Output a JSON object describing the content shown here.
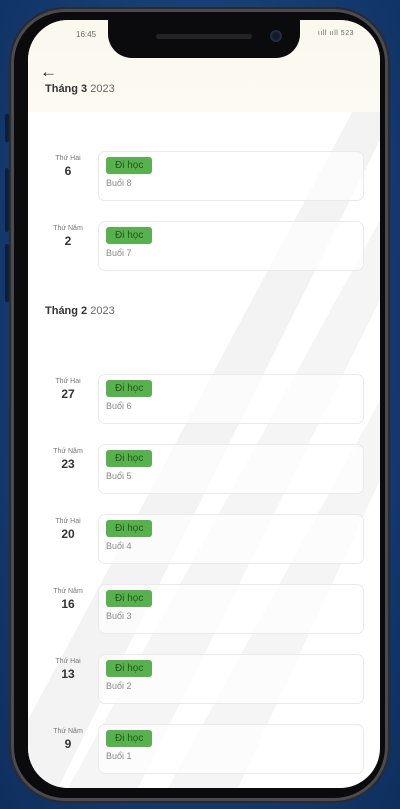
{
  "status": {
    "time": "16:45",
    "indicators": "ııll ııll 523"
  },
  "nav": {
    "back_icon": "←"
  },
  "sections": [
    {
      "month_label": "Tháng 3",
      "year": "2023",
      "entries": [
        {
          "weekday": "Thứ Hai",
          "day": "6",
          "status": "Đi học",
          "session": "Buổi 8"
        },
        {
          "weekday": "Thứ Năm",
          "day": "2",
          "status": "Đi học",
          "session": "Buổi 7"
        }
      ]
    },
    {
      "month_label": "Tháng 2",
      "year": "2023",
      "entries": [
        {
          "weekday": "Thứ Hai",
          "day": "27",
          "status": "Đi học",
          "session": "Buổi 6"
        },
        {
          "weekday": "Thứ Năm",
          "day": "23",
          "status": "Đi học",
          "session": "Buổi 5"
        },
        {
          "weekday": "Thứ Hai",
          "day": "20",
          "status": "Đi học",
          "session": "Buổi 4"
        },
        {
          "weekday": "Thứ Năm",
          "day": "16",
          "status": "Đi học",
          "session": "Buổi 3"
        },
        {
          "weekday": "Thứ Hai",
          "day": "13",
          "status": "Đi học",
          "session": "Buổi 2"
        },
        {
          "weekday": "Thứ Năm",
          "day": "9",
          "status": "Đi học",
          "session": "Buổi 1"
        }
      ]
    }
  ],
  "colors": {
    "badge_bg": "#59b04f",
    "badge_text": "#1e5a18",
    "background": "#153d75"
  }
}
